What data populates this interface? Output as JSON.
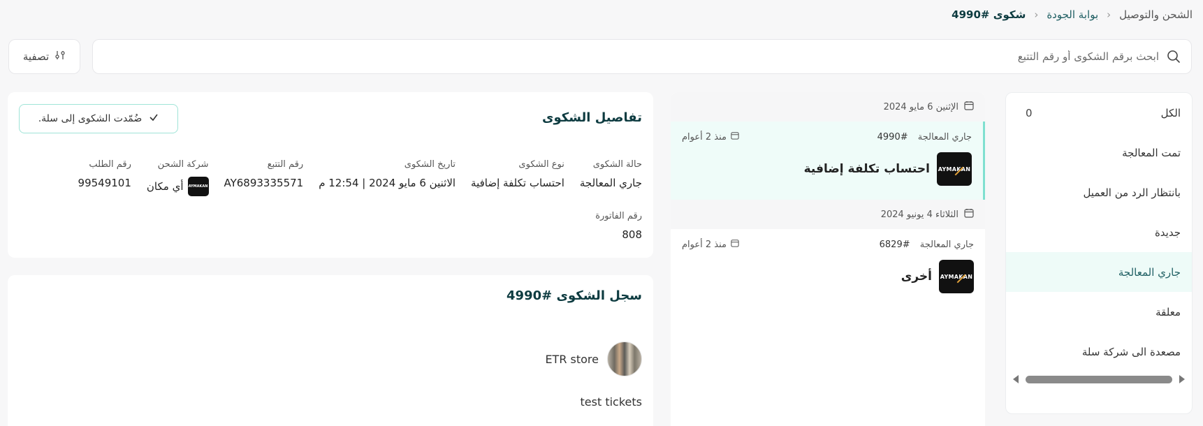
{
  "breadcrumb": {
    "items": [
      "الشحن والتوصيل",
      "بوابة الجودة",
      "شكوى #4990"
    ]
  },
  "search": {
    "placeholder": "ابحث برقم الشكوى أو رقم التتبع",
    "icon": "search-icon"
  },
  "filter": {
    "label": "تصفية",
    "icon": "sliders-icon"
  },
  "sidebar": {
    "items": [
      {
        "label": "الكل",
        "count": "0"
      },
      {
        "label": "تمت المعالجة",
        "count": ""
      },
      {
        "label": "بانتظار الرد من العميل",
        "count": ""
      },
      {
        "label": "جديدة",
        "count": ""
      },
      {
        "label": "جاري المعالجة",
        "count": ""
      },
      {
        "label": "معلقة",
        "count": ""
      },
      {
        "label": "مصعدة الى شركة سلة",
        "count": ""
      }
    ],
    "active_index": 4
  },
  "tickets": {
    "groups": [
      {
        "date": "الإثنين 6 مايو 2024",
        "ticket": {
          "status": "جاري المعالجة",
          "number": "#4990",
          "age": "منذ 2 أعوام",
          "title": "احتساب تكلفة إضافية",
          "logo_text": "AYMAKAN"
        }
      },
      {
        "date": "الثلاثاء 4 يونيو 2024",
        "ticket": {
          "status": "جاري المعالجة",
          "number": "#6829",
          "age": "منذ 2 أعوام",
          "title": "أخرى",
          "logo_text": "AYMAKAN"
        }
      }
    ]
  },
  "details": {
    "title": "تفاصيل الشكوى",
    "basket_badge": "ضُمّدت الشكوى إلى سلة.",
    "fields": [
      {
        "label": "حالة الشكوى",
        "value": "جاري المعالجة"
      },
      {
        "label": "نوع الشكوى",
        "value": "احتساب تكلفة إضافية"
      },
      {
        "label": "تاريخ الشكوى",
        "value": "الاثنين 6 مايو 2024 | 12:54 م"
      },
      {
        "label": "رقم التتبع",
        "value": "AY6893335571"
      },
      {
        "label": "شركة الشحن",
        "value": "أي مكان"
      },
      {
        "label": "رقم الطلب",
        "value": "99549101"
      }
    ],
    "invoice": {
      "label": "رقم الفاتورة",
      "value": "808"
    },
    "carrier_logo_text": "AYMAKAN"
  },
  "log": {
    "title": "سجل الشكوى #4990",
    "store_name": "ETR store",
    "message": "test tickets"
  },
  "colors": {
    "accent": "#1f5f63",
    "active_bg": "#eefbf8",
    "badge_border": "#9fe4d7"
  }
}
